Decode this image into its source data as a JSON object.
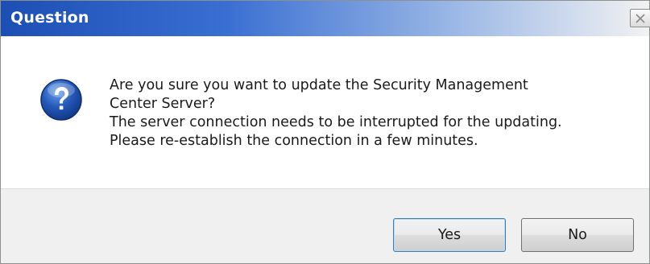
{
  "window": {
    "title": "Question",
    "close_icon": "close-icon"
  },
  "message": {
    "icon": "question-icon",
    "lines": [
      "Are you sure you want to update the Security Management",
      "Center Server?",
      "The server connection needs to be interrupted for the updating.",
      "Please re-establish the connection in a few minutes."
    ]
  },
  "buttons": {
    "yes_label": "Yes",
    "no_label": "No"
  },
  "colors": {
    "titlebar_start": "#1c4fb4",
    "titlebar_end": "#f2f2f2",
    "icon_blue": "#2458b8",
    "footer_bg": "#f0f0f0"
  }
}
